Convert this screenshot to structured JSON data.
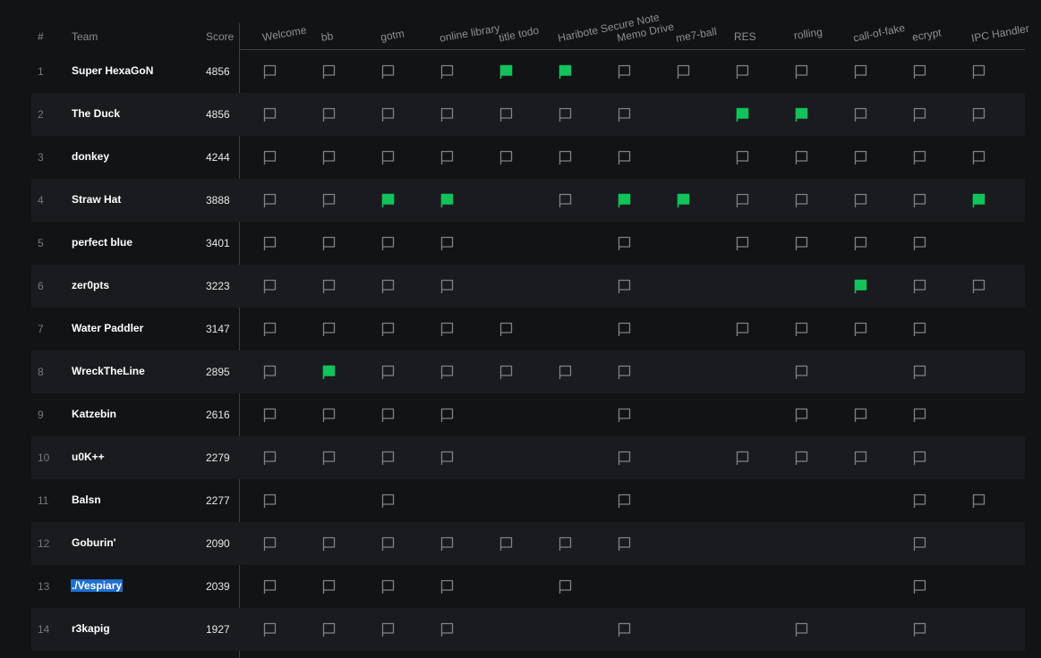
{
  "header": {
    "rank_label": "#",
    "team_label": "Team",
    "score_label": "Score"
  },
  "challenges": [
    "Welcome",
    "bb",
    "gotm",
    "online library",
    "title todo",
    "Haribote Secure Note",
    "Memo Drive",
    "me7-ball",
    "RES",
    "rolling",
    "call-of-fake",
    "ecrypt",
    "IPC Handler"
  ],
  "colors": {
    "solved": "#12c25a",
    "attempted": "#7f8288",
    "background": "#121315",
    "row_alt": "#1a1b1e",
    "selection": "#1e6fd0"
  },
  "icons": {
    "solved": "flag-filled-icon",
    "attempted": "flag-outline-icon"
  },
  "rows": [
    {
      "rank": "1",
      "team": "Super HexaGoN",
      "score": "4856",
      "status": [
        "o",
        "o",
        "o",
        "o",
        "s",
        "s",
        "o",
        "o",
        "o",
        "o",
        "o",
        "o",
        "o"
      ]
    },
    {
      "rank": "2",
      "team": "The Duck",
      "score": "4856",
      "status": [
        "o",
        "o",
        "o",
        "o",
        "o",
        "o",
        "o",
        "-",
        "s",
        "s",
        "o",
        "o",
        "o"
      ]
    },
    {
      "rank": "3",
      "team": "donkey",
      "score": "4244",
      "status": [
        "o",
        "o",
        "o",
        "o",
        "o",
        "o",
        "o",
        "-",
        "o",
        "o",
        "o",
        "o",
        "o"
      ]
    },
    {
      "rank": "4",
      "team": "Straw Hat",
      "score": "3888",
      "status": [
        "o",
        "o",
        "s",
        "s",
        "-",
        "o",
        "s",
        "s",
        "o",
        "o",
        "o",
        "o",
        "s"
      ]
    },
    {
      "rank": "5",
      "team": "perfect blue",
      "score": "3401",
      "status": [
        "o",
        "o",
        "o",
        "o",
        "-",
        "-",
        "o",
        "-",
        "o",
        "o",
        "o",
        "o",
        "-"
      ]
    },
    {
      "rank": "6",
      "team": "zer0pts",
      "score": "3223",
      "status": [
        "o",
        "o",
        "o",
        "o",
        "-",
        "-",
        "o",
        "-",
        "-",
        "-",
        "s",
        "o",
        "o"
      ]
    },
    {
      "rank": "7",
      "team": "Water Paddler",
      "score": "3147",
      "status": [
        "o",
        "o",
        "o",
        "o",
        "o",
        "-",
        "o",
        "-",
        "o",
        "o",
        "o",
        "o",
        "-"
      ]
    },
    {
      "rank": "8",
      "team": "WreckTheLine",
      "score": "2895",
      "status": [
        "o",
        "s",
        "o",
        "o",
        "o",
        "o",
        "o",
        "-",
        "-",
        "o",
        "-",
        "o",
        "-"
      ]
    },
    {
      "rank": "9",
      "team": "Katzebin",
      "score": "2616",
      "status": [
        "o",
        "o",
        "o",
        "o",
        "-",
        "-",
        "o",
        "-",
        "-",
        "o",
        "o",
        "o",
        "-"
      ]
    },
    {
      "rank": "10",
      "team": "u0K++",
      "score": "2279",
      "status": [
        "o",
        "o",
        "o",
        "o",
        "-",
        "-",
        "o",
        "-",
        "o",
        "o",
        "o",
        "o",
        "-"
      ]
    },
    {
      "rank": "11",
      "team": "Balsn",
      "score": "2277",
      "status": [
        "o",
        "-",
        "o",
        "-",
        "-",
        "-",
        "o",
        "-",
        "-",
        "-",
        "-",
        "o",
        "o"
      ]
    },
    {
      "rank": "12",
      "team": "Goburin'",
      "score": "2090",
      "status": [
        "o",
        "o",
        "o",
        "o",
        "o",
        "o",
        "o",
        "-",
        "-",
        "-",
        "-",
        "o",
        "-"
      ]
    },
    {
      "rank": "13",
      "team": "./Vespiary",
      "score": "2039",
      "selected": true,
      "status": [
        "o",
        "o",
        "o",
        "o",
        "-",
        "o",
        "-",
        "-",
        "-",
        "-",
        "-",
        "o",
        "-"
      ]
    },
    {
      "rank": "14",
      "team": "r3kapig",
      "score": "1927",
      "status": [
        "o",
        "o",
        "o",
        "o",
        "-",
        "-",
        "o",
        "-",
        "-",
        "o",
        "-",
        "o",
        "-"
      ]
    }
  ]
}
